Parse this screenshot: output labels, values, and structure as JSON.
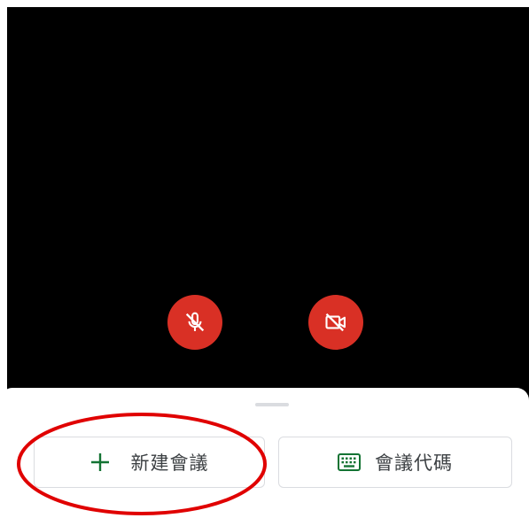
{
  "video_preview": {
    "mic_button": {
      "icon": "mic-off-icon",
      "state": "muted",
      "color": "#d93025"
    },
    "camera_button": {
      "icon": "videocam-off-icon",
      "state": "off",
      "color": "#d93025"
    }
  },
  "bottom_sheet": {
    "new_meeting": {
      "icon": "plus-icon",
      "label": "新建會議"
    },
    "join_with_code": {
      "icon": "keyboard-icon",
      "label": "會議代碼"
    }
  },
  "colors": {
    "accent": "#137333",
    "danger": "#d93025",
    "annotation": "#e00000"
  }
}
